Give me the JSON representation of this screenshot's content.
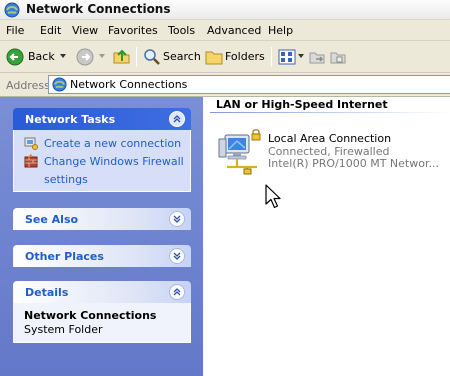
{
  "window": {
    "title": "Network Connections"
  },
  "menu": {
    "items": [
      "File",
      "Edit",
      "View",
      "Favorites",
      "Tools",
      "Advanced",
      "Help"
    ]
  },
  "toolbar": {
    "back_label": "Back",
    "search_label": "Search",
    "folders_label": "Folders"
  },
  "address": {
    "label": "Address",
    "value": "Network Connections"
  },
  "sidebar": {
    "network_tasks": {
      "title": "Network Tasks",
      "items": [
        "Create a new connection",
        "Change Windows Firewall",
        "settings"
      ]
    },
    "see_also": {
      "title": "See Also"
    },
    "other_places": {
      "title": "Other Places"
    },
    "details": {
      "title": "Details",
      "name": "Network Connections",
      "type": "System Folder"
    }
  },
  "content": {
    "group_header": "LAN or High-Speed Internet",
    "connection": {
      "name": "Local Area Connection",
      "status": "Connected, Firewalled",
      "device": "Intel(R) PRO/1000 MT Networ..."
    }
  },
  "colors": {
    "link": "#215dc6",
    "taskpane": "#6f84d0",
    "panel_body": "#d6dff7",
    "chrome": "#ece9d8"
  },
  "icons": [
    "network-connections-icon",
    "back-arrow-icon",
    "forward-arrow-icon",
    "up-folder-icon",
    "search-icon",
    "folders-icon",
    "views-icon",
    "chevron-up-icon",
    "chevron-down-icon",
    "new-connection-icon",
    "firewall-icon",
    "lan-connection-icon",
    "mouse-pointer-icon"
  ]
}
